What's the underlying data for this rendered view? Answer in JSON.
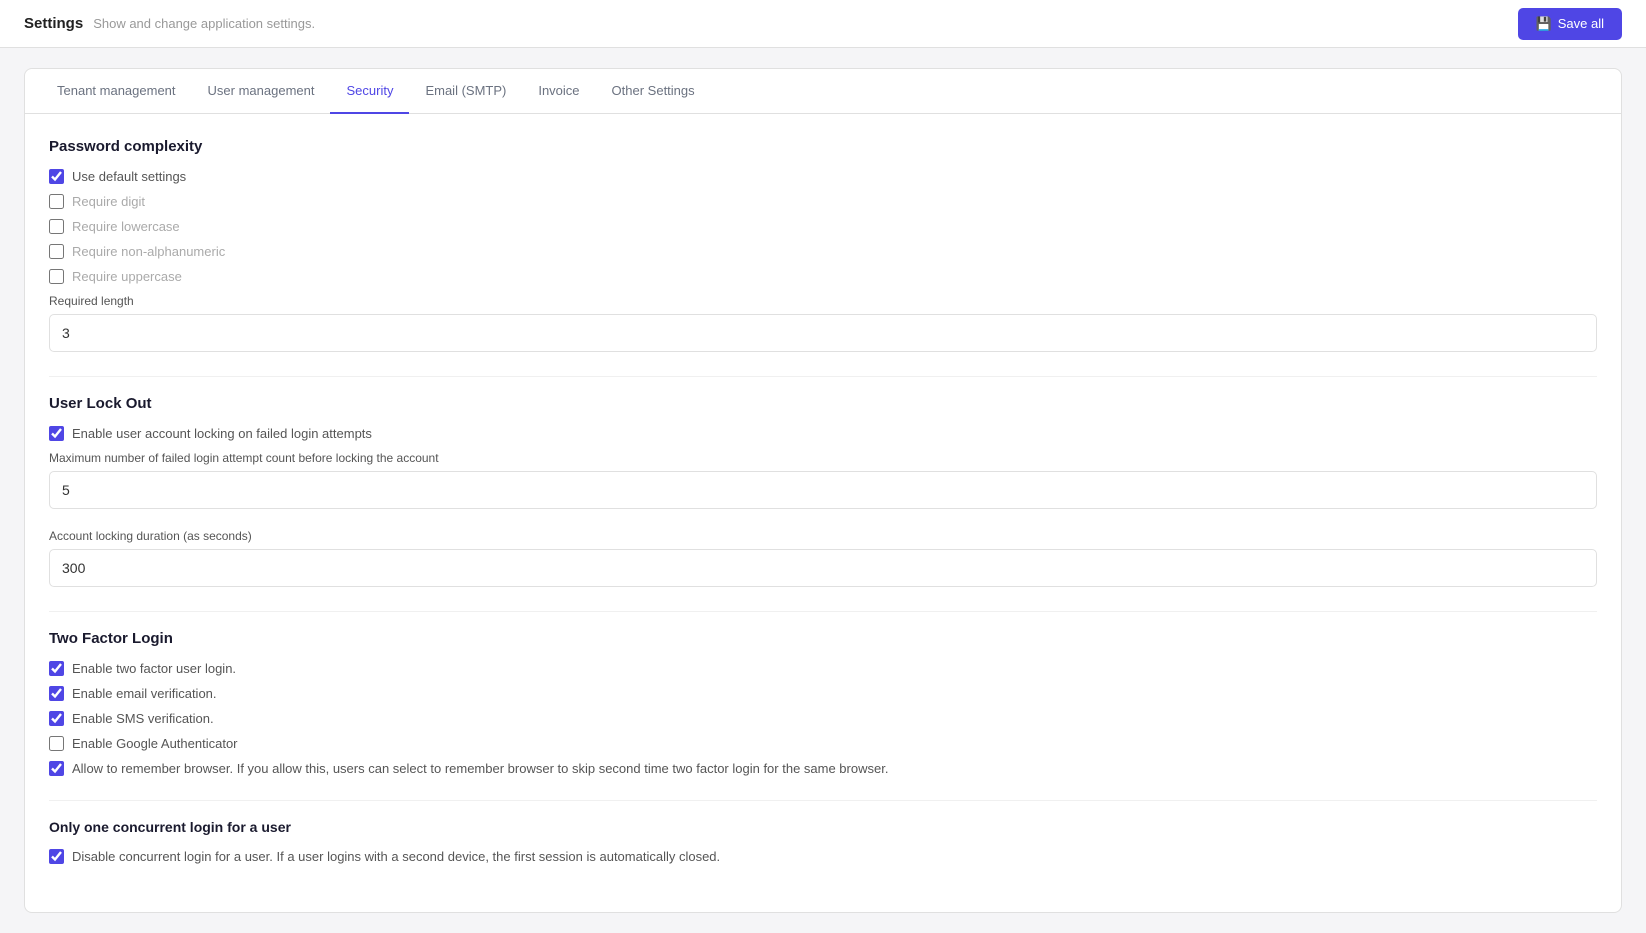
{
  "topbar": {
    "title": "Settings",
    "subtitle": "Show and change application settings.",
    "save_button": "Save all",
    "save_icon": "💾"
  },
  "tabs": [
    {
      "id": "tenant",
      "label": "Tenant management",
      "active": false
    },
    {
      "id": "user",
      "label": "User management",
      "active": false
    },
    {
      "id": "security",
      "label": "Security",
      "active": true
    },
    {
      "id": "email",
      "label": "Email (SMTP)",
      "active": false
    },
    {
      "id": "invoice",
      "label": "Invoice",
      "active": false
    },
    {
      "id": "other",
      "label": "Other Settings",
      "active": false
    }
  ],
  "sections": {
    "password_complexity": {
      "title": "Password complexity",
      "use_default": {
        "label": "Use default settings",
        "checked": true
      },
      "options": [
        {
          "id": "require_digit",
          "label": "Require digit",
          "checked": false,
          "muted": true
        },
        {
          "id": "require_lowercase",
          "label": "Require lowercase",
          "checked": false,
          "muted": true
        },
        {
          "id": "require_nonalphanumeric",
          "label": "Require non-alphanumeric",
          "checked": false,
          "muted": true
        },
        {
          "id": "require_uppercase",
          "label": "Require uppercase",
          "checked": false,
          "muted": true
        }
      ],
      "required_length": {
        "label": "Required length",
        "value": "3"
      }
    },
    "user_lock_out": {
      "title": "User Lock Out",
      "enable_locking": {
        "label": "Enable user account locking on failed login attempts",
        "checked": true
      },
      "max_attempts": {
        "label": "Maximum number of failed login attempt count before locking the account",
        "value": "5"
      },
      "lock_duration": {
        "label": "Account locking duration (as seconds)",
        "value": "300"
      }
    },
    "two_factor": {
      "title": "Two Factor Login",
      "options": [
        {
          "id": "enable_2fa",
          "label": "Enable two factor user login.",
          "checked": true,
          "muted": false
        },
        {
          "id": "enable_email_verify",
          "label": "Enable email verification.",
          "checked": true,
          "muted": false
        },
        {
          "id": "enable_sms_verify",
          "label": "Enable SMS verification.",
          "checked": true,
          "muted": false
        },
        {
          "id": "enable_google_auth",
          "label": "Enable Google Authenticator",
          "checked": false,
          "muted": false
        },
        {
          "id": "allow_remember_browser",
          "label": "Allow to remember browser. If you allow this, users can select to remember browser to skip second time two factor login for the same browser.",
          "checked": true,
          "muted": false
        }
      ]
    },
    "concurrent_login": {
      "title": "Only one concurrent login for a user",
      "disable_concurrent": {
        "label": "Disable concurrent login for a user. If a user logins with a second device, the first session is automatically closed.",
        "checked": true
      }
    }
  }
}
